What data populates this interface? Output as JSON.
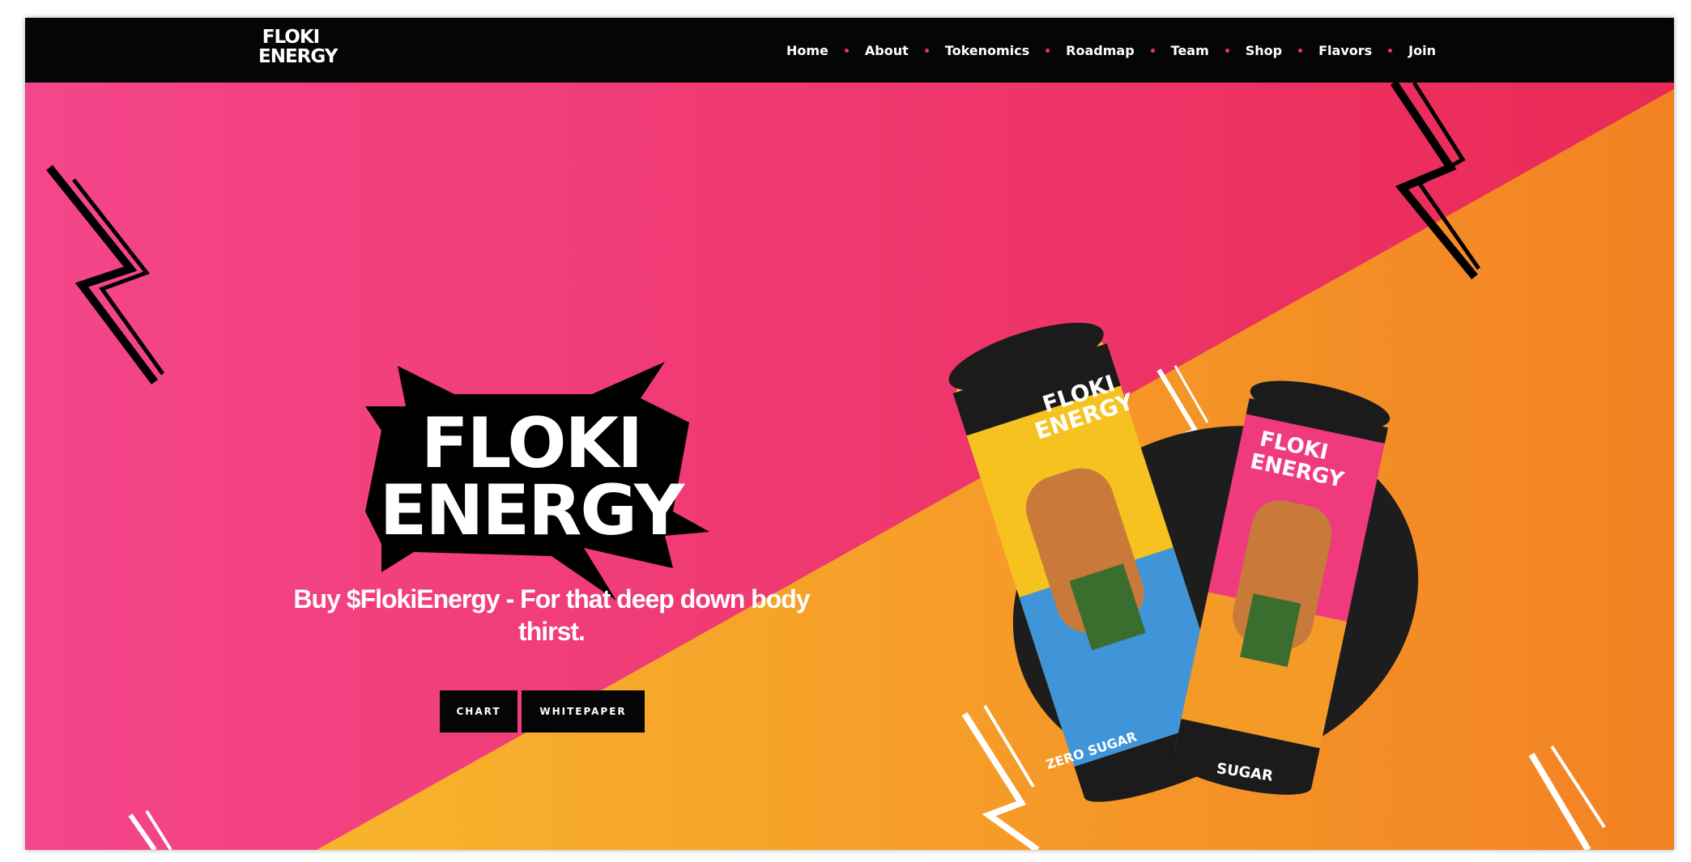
{
  "header": {
    "brand_line1": "FLOKI",
    "brand_line2": "ENERGY",
    "nav": [
      "Home",
      "About",
      "Tokenomics",
      "Roadmap",
      "Team",
      "Shop",
      "Flavors",
      "Join"
    ]
  },
  "hero": {
    "logo_line1": "FLOKI",
    "logo_line2": "ENERGY",
    "tagline_line1": "Buy $FlokiEnergy - For that deep down body",
    "tagline_line2": "thirst.",
    "buttons": {
      "chart": "CHART",
      "whitepaper": "WHITEPAPER"
    },
    "can1": {
      "brand_line1": "FLOKI",
      "brand_line2": "ENERGY",
      "flavor": "ZERO SUGAR"
    },
    "can2": {
      "brand_line1": "FLOKI",
      "brand_line2": "ENERGY",
      "flavor": "SUGAR"
    }
  },
  "colors": {
    "pink": "#f0417a",
    "orange": "#f39a27",
    "nav_bg": "#050505",
    "dot": "#e8336b"
  }
}
